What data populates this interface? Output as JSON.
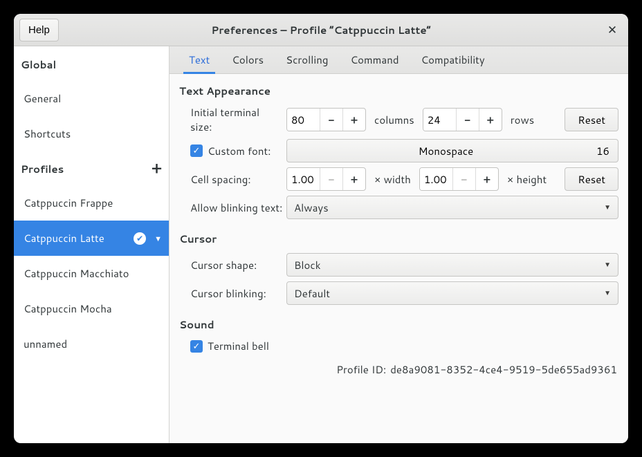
{
  "titlebar": {
    "help_label": "Help",
    "title": "Preferences – Profile “Catppuccin Latte”",
    "close_glyph": "✕"
  },
  "sidebar": {
    "global_header": "Global",
    "global_items": [
      "General",
      "Shortcuts"
    ],
    "profiles_header": "Profiles",
    "add_profile_glyph": "+",
    "profiles": [
      {
        "label": "Catppuccin Frappe",
        "selected": false
      },
      {
        "label": "Catppuccin Latte",
        "selected": true
      },
      {
        "label": "Catppuccin Macchiato",
        "selected": false
      },
      {
        "label": "Catppuccin Mocha",
        "selected": false
      },
      {
        "label": "unnamed",
        "selected": false
      }
    ],
    "check_glyph": "✔",
    "caret_glyph": "▼"
  },
  "tabs": [
    "Text",
    "Colors",
    "Scrolling",
    "Command",
    "Compatibility"
  ],
  "active_tab_index": 0,
  "text_appearance": {
    "section_title": "Text Appearance",
    "initial_size_label": "Initial terminal size:",
    "columns_value": "80",
    "columns_unit": "columns",
    "rows_value": "24",
    "rows_unit": "rows",
    "reset_label": "Reset",
    "custom_font_label": "Custom font:",
    "custom_font_checked": true,
    "font_name": "Monospace",
    "font_size": "16",
    "cell_spacing_label": "Cell spacing:",
    "cell_width_value": "1.00",
    "cell_width_unit": "× width",
    "cell_height_value": "1.00",
    "cell_height_unit": "× height",
    "allow_blinking_label": "Allow blinking text:",
    "allow_blinking_value": "Always"
  },
  "cursor": {
    "section_title": "Cursor",
    "shape_label": "Cursor shape:",
    "shape_value": "Block",
    "blinking_label": "Cursor blinking:",
    "blinking_value": "Default"
  },
  "sound": {
    "section_title": "Sound",
    "terminal_bell_label": "Terminal bell",
    "terminal_bell_checked": true
  },
  "footer": {
    "profile_id_label": "Profile ID:",
    "profile_id_value": "de8a9081-8352-4ce4-9519-5de655ad9361"
  },
  "glyphs": {
    "minus": "−",
    "plus": "+",
    "dropdown": "▼"
  }
}
